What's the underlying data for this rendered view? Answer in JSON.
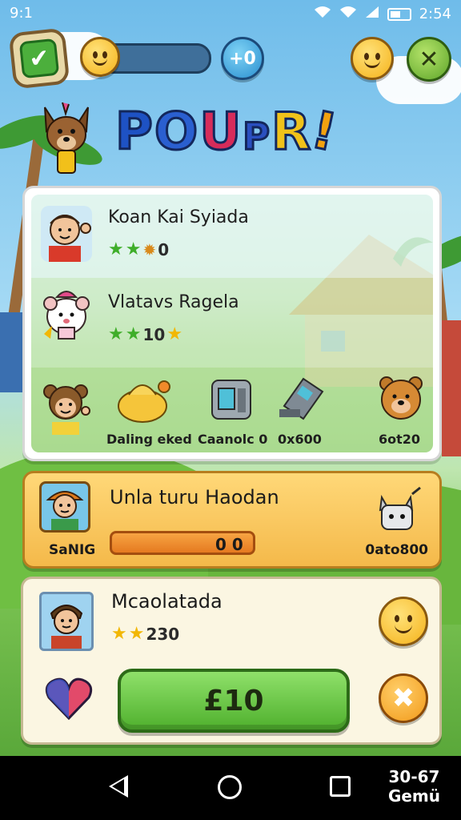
{
  "status_bar": {
    "left_text": "9:1",
    "time": "2:54"
  },
  "top_bar": {
    "plus_label": "+0",
    "close_icon": "close-icon",
    "check_icon": "check-icon"
  },
  "title": {
    "letters": [
      "P",
      "O",
      "U",
      "P",
      "R",
      "!"
    ]
  },
  "main_card": {
    "players": [
      {
        "name": "Koan Kai Syiada",
        "stars_label": "0"
      },
      {
        "name": "Vlatavs Ragela",
        "stars_label": "10"
      }
    ],
    "items": [
      {
        "label": "Daling eked"
      },
      {
        "label": "Caanolc 0"
      },
      {
        "label": "0x600"
      },
      {
        "label": "6ot20"
      }
    ]
  },
  "quest_card": {
    "title": "Unla turu Haodan",
    "progress_label": "0 0",
    "progress": 0.0,
    "player_name": "SaNIG",
    "reward_label": "0ato800"
  },
  "profile_card": {
    "title": "Mcaolatada",
    "stars_label": "230",
    "play_button_label": "£10"
  },
  "nav_bar": {
    "corner_line1": "30-67",
    "corner_line2": "Gemü"
  },
  "colors": {
    "title_blue": "#2457c8",
    "play_green": "#4fb02d",
    "quest_orange": "#f4b94a"
  }
}
